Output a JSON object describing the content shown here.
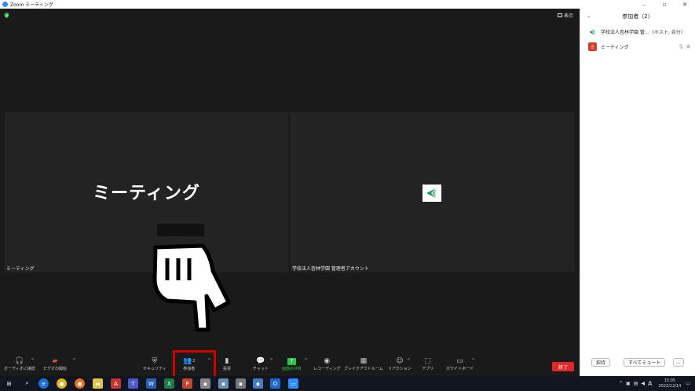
{
  "window": {
    "title": "Zoom ミーティング",
    "controls": [
      "–",
      "▫",
      "✕"
    ]
  },
  "meeting": {
    "view_label": "表示",
    "tiles": [
      {
        "big_name": "ミーティング",
        "label": "ミーティング"
      },
      {
        "label": "学校法人杏林学園 管理者アカウント"
      }
    ]
  },
  "toolbar": {
    "items": [
      {
        "label": "オーディオに接続",
        "icon": "headphones-icon"
      },
      {
        "label": "ビデオの開始",
        "icon": "video-off-icon"
      },
      {
        "label": "セキュリティ",
        "icon": "shield-icon"
      },
      {
        "label": "参加者",
        "icon": "participants-icon",
        "count": "2"
      },
      {
        "label": "投票",
        "icon": "poll-icon"
      },
      {
        "label": "チャット",
        "icon": "chat-icon"
      },
      {
        "label": "画面の共有",
        "icon": "share-screen-icon"
      },
      {
        "label": "レコーディング",
        "icon": "record-icon"
      },
      {
        "label": "ブレイクアウトルーム",
        "icon": "breakout-icon"
      },
      {
        "label": "リアクション",
        "icon": "reaction-icon"
      },
      {
        "label": "アプリ",
        "icon": "apps-icon"
      },
      {
        "label": "ホワイトボード",
        "icon": "whiteboard-icon"
      }
    ],
    "end_label": "終了",
    "accent_green": "#2bc24a",
    "end_color": "#e02828",
    "highlight_color": "#d40000"
  },
  "panel": {
    "title": "参加者（2）",
    "participants": [
      {
        "name": "学校法人杏林学園 管...",
        "role": "(ホスト, 自分)"
      },
      {
        "name": "ミーティング",
        "avatar": "ミ"
      }
    ],
    "invite_label": "招待",
    "mute_all_label": "すべてミュート",
    "more_label": "..."
  },
  "taskbar": {
    "time": "15:05",
    "date": "2022/12/14",
    "ime": "A"
  }
}
